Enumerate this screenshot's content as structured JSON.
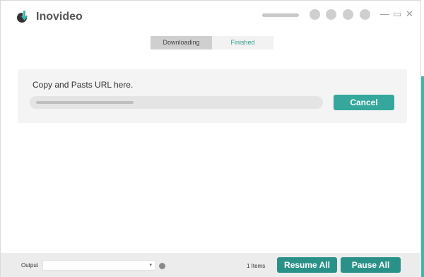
{
  "app": {
    "title": "Inovideo"
  },
  "tabs": [
    {
      "label": "Downloading",
      "active": true
    },
    {
      "label": "Finished",
      "active": false
    }
  ],
  "url_panel": {
    "label": "Copy and Pasts URL here.",
    "cancel_label": "Cancel"
  },
  "footer": {
    "output_label": "Output",
    "output_value": "",
    "select_arrow": "▾",
    "items_count": "1 Items",
    "resume_all_label": "Resume All",
    "pause_all_label": "Pause All"
  },
  "window_controls": {
    "minimize": "—",
    "maximize": "▭",
    "close": "✕"
  },
  "colors": {
    "accent": "#35a79c",
    "accent_dark": "#2a9189",
    "tab_text": "#2a9d8f"
  }
}
